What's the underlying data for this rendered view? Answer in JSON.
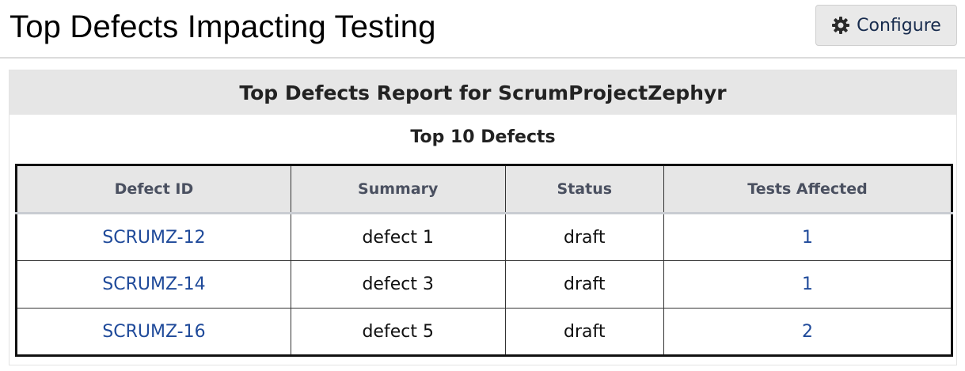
{
  "header": {
    "title": "Top Defects Impacting Testing",
    "configure_label": "Configure",
    "configure_icon": "gear-icon"
  },
  "report": {
    "title": "Top Defects Report for ScrumProjectZephyr",
    "subtitle": "Top 10 Defects",
    "columns": [
      "Defect ID",
      "Summary",
      "Status",
      "Tests Affected"
    ],
    "rows": [
      {
        "defect_id": "SCRUMZ-12",
        "summary": "defect 1",
        "status": "draft",
        "tests_affected": "1"
      },
      {
        "defect_id": "SCRUMZ-14",
        "summary": "defect 3",
        "status": "draft",
        "tests_affected": "1"
      },
      {
        "defect_id": "SCRUMZ-16",
        "summary": "defect 5",
        "status": "draft",
        "tests_affected": "2"
      }
    ]
  },
  "colors": {
    "link": "#1f4a9a",
    "header_bg": "#e6e6e6",
    "button_bg": "#e9e9e9"
  }
}
